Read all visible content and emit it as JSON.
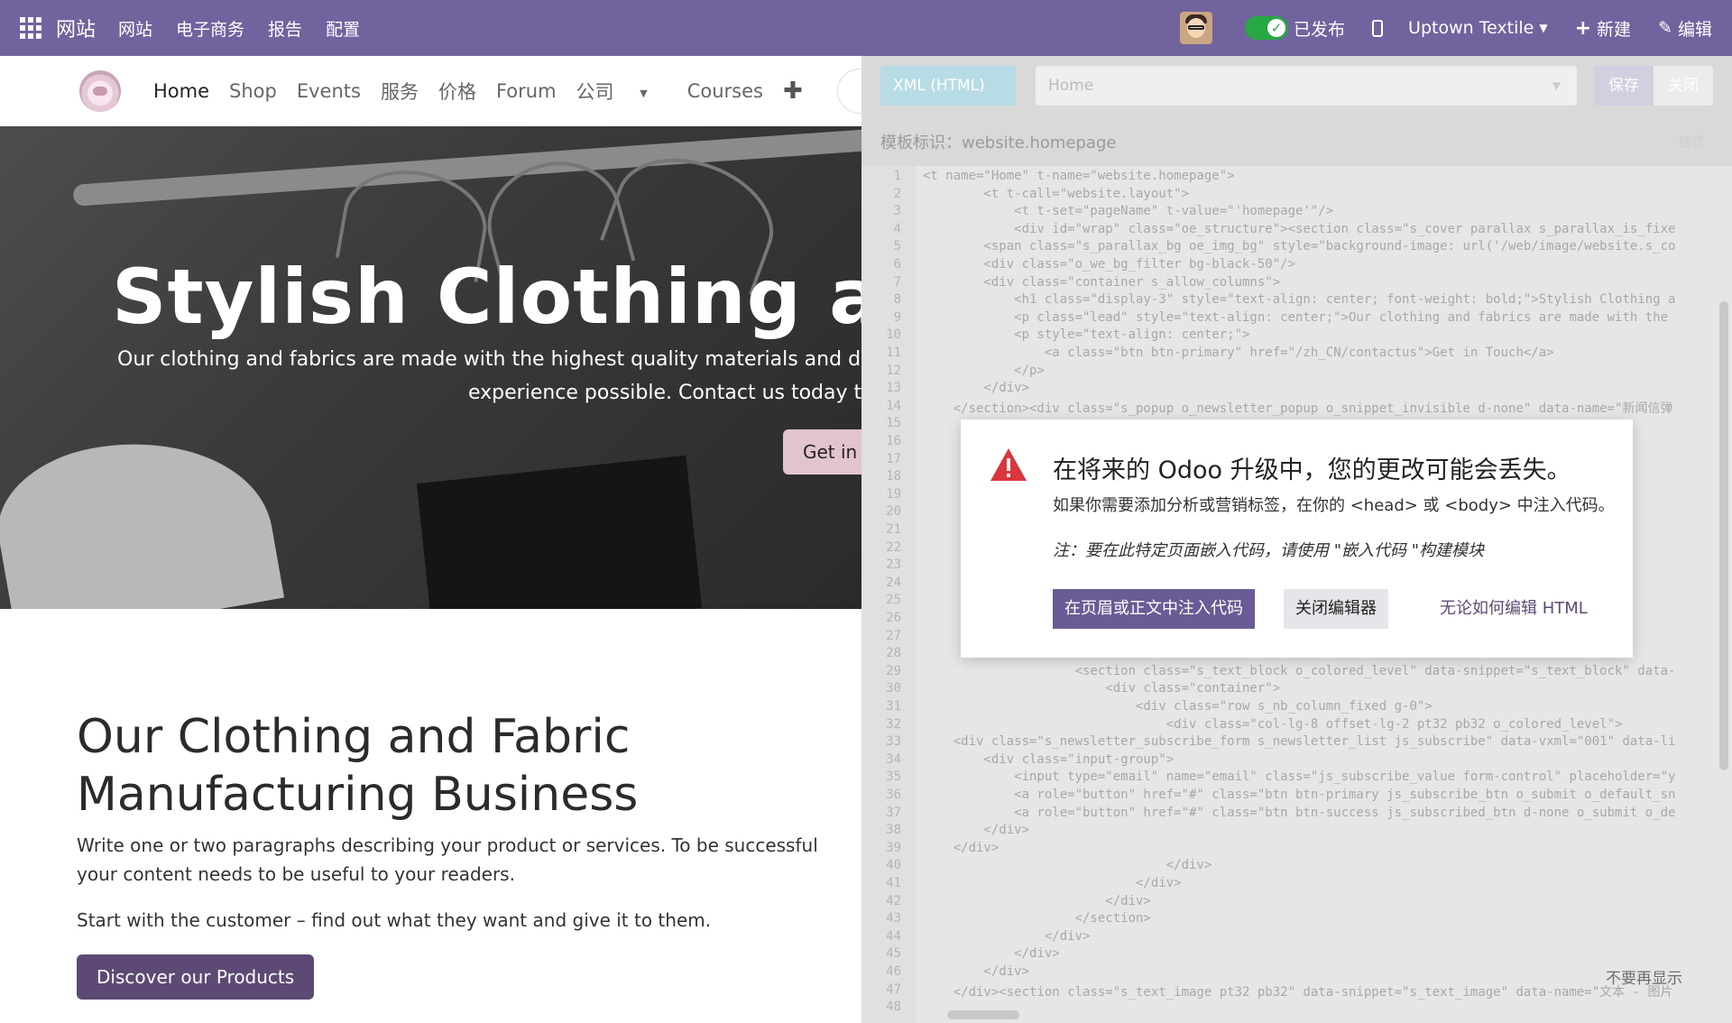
{
  "topbar": {
    "brand": "网站",
    "menus": [
      "网站",
      "电子商务",
      "报告",
      "配置"
    ],
    "published_label": "已发布",
    "website_switcher": "Uptown Textile",
    "new_label": "新建",
    "edit_label": "编辑",
    "colors": {
      "bar": "#71639e",
      "toggle_on": "#28a745"
    }
  },
  "site_nav": {
    "links": [
      "Home",
      "Shop",
      "Events",
      "服务",
      "价格",
      "Forum",
      "公司",
      "Courses"
    ],
    "active": "Home"
  },
  "hero": {
    "title": "Stylish Clothing and",
    "lead_line1": "Our clothing and fabrics are made with the highest quality materials and designed",
    "lead_line2": "experience possible. Contact us today to lea",
    "button": "Get in T"
  },
  "about": {
    "heading": "Our Clothing and Fabric Manufacturing Business",
    "paragraph1": "Write one or two paragraphs describing your product or services. To be successful your content needs to be useful to your readers.",
    "paragraph2": "Start with the customer – find out what they want and give it to them.",
    "button": "Discover our Products"
  },
  "editor": {
    "mode": "XML (HTML)",
    "page_selected": "Home",
    "save_label": "保存",
    "close_label": "关闭",
    "template_label": "模板标识：website.homepage",
    "format_label": "格式",
    "dont_show_again": "不要再显示",
    "code_lines": [
      "<t name=\"Home\" t-name=\"website.homepage\">",
      "        <t t-call=\"website.layout\">",
      "            <t t-set=\"pageName\" t-value=\"'homepage'\"/>",
      "            <div id=\"wrap\" class=\"oe_structure\"><section class=\"s_cover parallax s_parallax_is_fixe",
      "        <span class=\"s_parallax_bg oe_img_bg\" style=\"background-image: url('/web/image/website.s_co",
      "        <div class=\"o_we_bg_filter bg-black-50\"/>",
      "        <div class=\"container s_allow_columns\">",
      "            <h1 class=\"display-3\" style=\"text-align: center; font-weight: bold;\">Stylish Clothing a",
      "            <p class=\"lead\" style=\"text-align: center;\">Our clothing and fabrics are made with the",
      "            <p style=\"text-align: center;\">",
      "                <a class=\"btn btn-primary\" href=\"/zh_CN/contactus\">Get in Touch</a>",
      "            </p>",
      "        </div>",
      "    </section><div class=\"s_popup o_newsletter_popup o_snippet_invisible d-none\" data-name=\"新闻信弹",
      "",
      "",
      "",
      "",
      "",
      "",
      "",
      "",
      "",
      "",
      "",
      "",
      "",
      "",
      "                    <section class=\"s_text_block o_colored_level\" data-snippet=\"s_text_block\" data-",
      "                        <div class=\"container\">",
      "                            <div class=\"row s_nb_column_fixed g-0\">",
      "                                <div class=\"col-lg-8 offset-lg-2 pt32 pb32 o_colored_level\">",
      "    <div class=\"s_newsletter_subscribe_form s_newsletter_list js_subscribe\" data-vxml=\"001\" data-li",
      "        <div class=\"input-group\">",
      "            <input type=\"email\" name=\"email\" class=\"js_subscribe_value form-control\" placeholder=\"y",
      "            <a role=\"button\" href=\"#\" class=\"btn btn-primary js_subscribe_btn o_submit o_default_sn",
      "            <a role=\"button\" href=\"#\" class=\"btn btn-success js_subscribed_btn d-none o_submit o_de",
      "        </div>",
      "    </div>",
      "                                </div>",
      "                            </div>",
      "                        </div>",
      "                    </section>",
      "                </div>",
      "            </div>",
      "        </div>",
      "    </div><section class=\"s_text_image pt32 pb32\" data-snippet=\"s_text_image\" data-name=\"文本 - 图片",
      ""
    ]
  },
  "dialog": {
    "title": "在将来的 Odoo 升级中，您的更改可能会丢失。",
    "body": "如果你需要添加分析或营销标签，在你的 <head> 或 <body> 中注入代码。",
    "note": "注：要在此特定页面嵌入代码，请使用 \"嵌入代码 \"构建模块",
    "btn_inject": "在页眉或正文中注入代码",
    "btn_close_editor": "关闭编辑器",
    "btn_edit_anyway": "无论如何编辑 HTML",
    "icon": "warning-triangle-icon",
    "colors": {
      "icon": "#d9363e",
      "primary": "#6b5b95"
    }
  }
}
